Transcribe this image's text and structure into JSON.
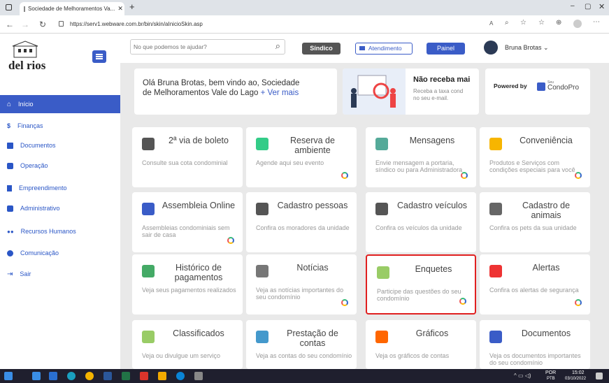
{
  "browser": {
    "tab_title": "Sociedade de Melhoramentos Va...",
    "url": "https://serv1.webware.com.br/bin/skin/aInicioSkin.asp"
  },
  "logo": {
    "text": "del rios"
  },
  "search": {
    "placeholder": "No que podemos te ajudar?"
  },
  "topbar": {
    "sindico": "Síndico",
    "atendimento": "Atendimento",
    "painel": "Painel",
    "user": "Bruna Brotas ⌄"
  },
  "sidebar": {
    "items": [
      {
        "label": "Início"
      },
      {
        "label": "Finanças"
      },
      {
        "label": "Documentos"
      },
      {
        "label": "Operação"
      },
      {
        "label": "Empreendimento"
      },
      {
        "label": "Administrativo"
      },
      {
        "label": "Recursos Humanos"
      },
      {
        "label": "Comunicação"
      },
      {
        "label": "Sair"
      }
    ]
  },
  "welcome": {
    "line1": "Olá Bruna Brotas, bem vindo ao, Sociedade",
    "line2": "de Melhoramentos Vale do Lago",
    "more": "+ Ver mais"
  },
  "promo": {
    "title": "Não receba mai",
    "desc1": "Receba a taxa cond",
    "desc2": "no seu e-mail."
  },
  "powered": {
    "label": "Powered by",
    "brand_small": "Seu",
    "brand": "CondoPro"
  },
  "cards": [
    {
      "title": "2ª via de boleto",
      "desc": "Consulte sua cota condominial"
    },
    {
      "title": "Reserva de ambiente",
      "desc": "Agende aqui seu evento"
    },
    {
      "title": "Mensagens",
      "desc": "Envie mensagem a portaria, síndico ou para Administradora"
    },
    {
      "title": "Conveniência",
      "desc": "Produtos e Serviços com condições especiais para você"
    },
    {
      "title": "Assembleia Online",
      "desc": "Assembleias condominiais sem sair de casa"
    },
    {
      "title": "Cadastro pessoas",
      "desc": "Confira os moradores da unidade"
    },
    {
      "title": "Cadastro veículos",
      "desc": "Confira os veículos da unidade"
    },
    {
      "title": "Cadastro de animais",
      "desc": "Confira os pets da sua unidade"
    },
    {
      "title": "Histórico de pagamentos",
      "desc": "Veja seus pagamentos realizados"
    },
    {
      "title": "Notícias",
      "desc": "Veja as notícias importantes do seu condomínio"
    },
    {
      "title": "Enquetes",
      "desc": "Participe das questões do seu condomínio"
    },
    {
      "title": "Alertas",
      "desc": "Confira os alertas de segurança"
    },
    {
      "title": "Classificados",
      "desc": "Veja ou divulgue um serviço"
    },
    {
      "title": "Prestação de contas",
      "desc": "Veja as contas do seu condomínio"
    },
    {
      "title": "Gráficos",
      "desc": "Veja os gráficos de contas"
    },
    {
      "title": "Documentos",
      "desc": "Veja os documentos importantes do seu condomínio"
    }
  ],
  "taskbar": {
    "lang1": "POR",
    "lang2": "PTB",
    "time": "15:02",
    "date": "03/10/2022"
  }
}
